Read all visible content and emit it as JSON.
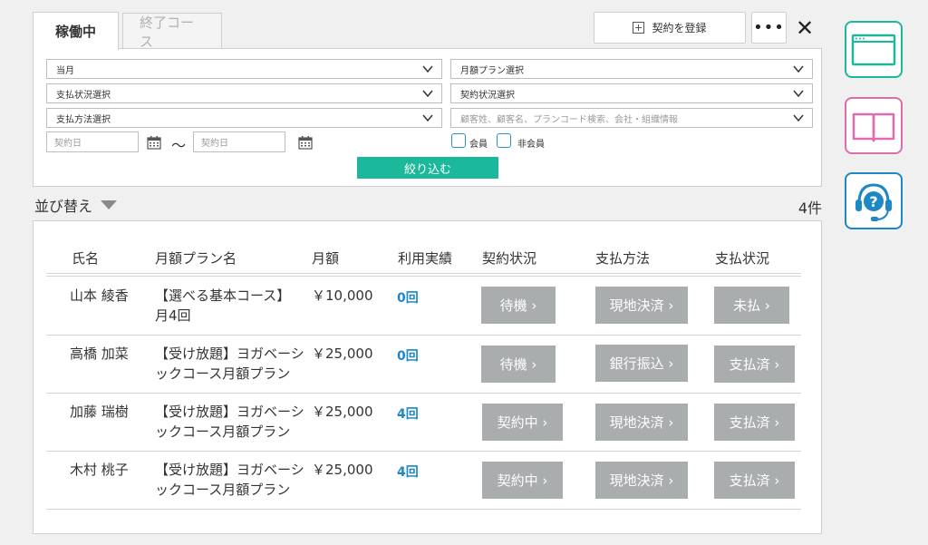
{
  "tabs": [
    {
      "label": "稼働中"
    },
    {
      "label": "終了コース"
    }
  ],
  "toolbar": {
    "register_label": "契約を登録",
    "more_label": "•••",
    "close_label": "✕"
  },
  "filters": {
    "month": "当月",
    "plan": "月額プラン選択",
    "payment_status": "支払状況選択",
    "contract_status": "契約状況選択",
    "payment_method": "支払方法選択",
    "search_placeholder": "顧客姓、顧客名、プランコード検索、会社・組織情報",
    "date_from_placeholder": "契約日",
    "date_to_placeholder": "契約日",
    "tilde": "〜",
    "member_label": "会員",
    "non_member_label": "非会員",
    "apply_label": "絞り込む"
  },
  "sort_label": "並び替え",
  "count_label": "4件",
  "table": {
    "headers": [
      "氏名",
      "月額プラン名",
      "月額",
      "利用実績",
      "契約状況",
      "支払方法",
      "支払状況"
    ],
    "rows": [
      {
        "name": "山本 綾香",
        "plan_line1": "【選べる基本コース】",
        "plan_line2": "月4回",
        "price": "￥10,000",
        "usage": "0回",
        "contract": "待機 ›",
        "method": "現地決済 ›",
        "status": "未払 ›"
      },
      {
        "name": "高橋 加菜",
        "plan_line1": "【受け放題】ヨガベーシ",
        "plan_line2": "ックコース月額プラン",
        "price": "￥25,000",
        "usage": "0回",
        "contract": "待機 ›",
        "method": "銀行振込 ›",
        "status": "支払済 ›"
      },
      {
        "name": "加藤 瑞樹",
        "plan_line1": "【受け放題】ヨガベーシ",
        "plan_line2": "ックコース月額プラン",
        "price": "￥25,000",
        "usage": "4回",
        "contract": "契約中 ›",
        "method": "現地決済 ›",
        "status": "支払済 ›"
      },
      {
        "name": "木村 桃子",
        "plan_line1": "【受け放題】ヨガベーシ",
        "plan_line2": "ックコース月額プラン",
        "price": "￥25,000",
        "usage": "4回",
        "contract": "契約中 ›",
        "method": "現地決済 ›",
        "status": "支払済 ›"
      }
    ]
  },
  "sidebar": {
    "icons": [
      {
        "name": "browser-window-icon",
        "color": "#1bb89b"
      },
      {
        "name": "open-book-icon",
        "color": "#e06cb0"
      },
      {
        "name": "support-headset-icon",
        "color": "#1e88c7"
      }
    ]
  },
  "colors": {
    "accent_green": "#1bb89b",
    "usage_blue": "#1e88c7",
    "status_button_gray": "#a9adad"
  }
}
